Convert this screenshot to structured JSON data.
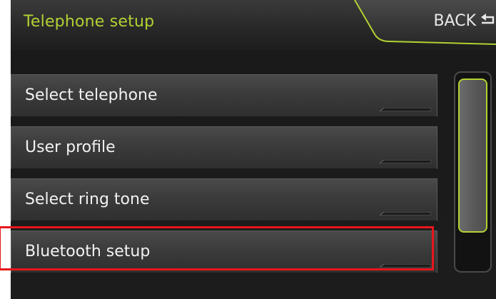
{
  "header": {
    "title": "Telephone setup",
    "back_label": "BACK"
  },
  "menu": {
    "items": [
      {
        "label": "Select telephone"
      },
      {
        "label": "User profile"
      },
      {
        "label": "Select ring tone"
      },
      {
        "label": "Bluetooth setup"
      }
    ]
  },
  "highlighted_item": "Bluetooth setup",
  "scrollbar": {
    "visible_fraction": 0.78
  },
  "colors": {
    "accent": "#b2d234",
    "highlight_box": "#e8161b",
    "text": "#f2f2f2"
  },
  "icons": {
    "back": "return-arrow-icon"
  }
}
